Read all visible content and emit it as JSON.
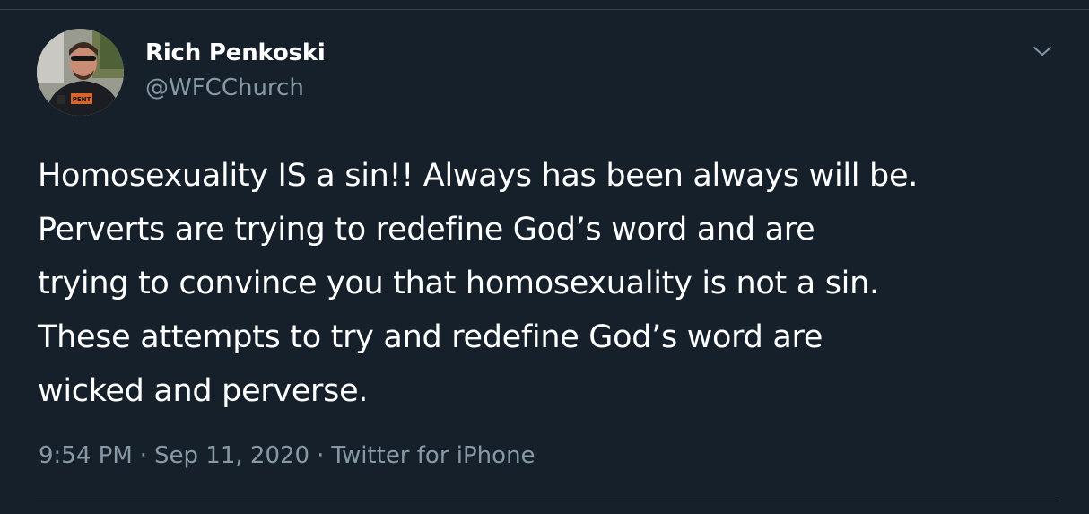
{
  "author": {
    "display_name": "Rich Penkoski",
    "handle": "@WFCChurch",
    "avatar_badge": "PENT"
  },
  "tweet": {
    "lines": [
      "Homosexuality IS a sin!! Always has been always will be.",
      "Perverts are trying to redefine God’s word and are",
      "trying to convince you that homosexuality is not a sin.",
      "These attempts to try and redefine God’s word are",
      "wicked and perverse."
    ],
    "time": "9:54 PM",
    "separator": "·",
    "date": "Sep 11, 2020",
    "source": "Twitter for iPhone"
  },
  "icons": {
    "menu": "chevron-down-icon",
    "avatar": "profile-photo"
  },
  "colors": {
    "background": "#15202b",
    "primary_text": "#ffffff",
    "secondary_text": "#8899a6",
    "divider": "#38444d"
  }
}
